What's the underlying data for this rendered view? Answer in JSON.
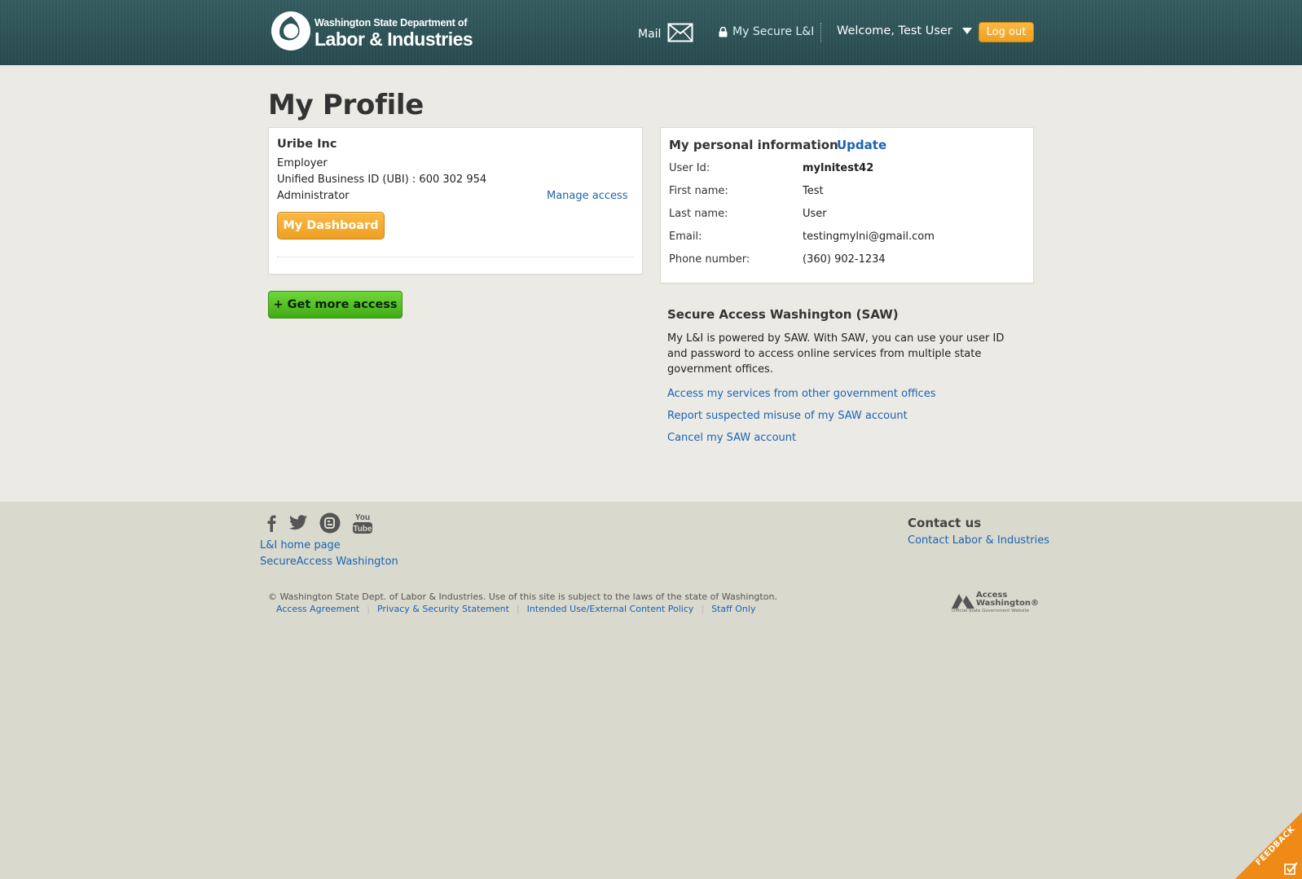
{
  "header": {
    "logo_line1": "Washington State Department of",
    "logo_line2": "Labor & Industries",
    "mail_label": "Mail",
    "mail_icon": "envelope-icon",
    "secure_label": "My Secure L&I",
    "secure_icon": "lock-icon",
    "welcome_label": "Welcome, Test User",
    "welcome_icon": "caret-down-icon",
    "logout_label": "Log out"
  },
  "page": {
    "title": "My Profile"
  },
  "employer": {
    "name": "Uribe Inc",
    "role_type": "Employer",
    "ubi": "Unified Business ID (UBI) : 600 302 954",
    "access_level": "Administrator",
    "manage_access_label": "Manage access",
    "dashboard_label": "My Dashboard"
  },
  "get_more_access_label": "+ Get more access",
  "personal": {
    "title": "My personal information",
    "update_label": "Update",
    "fields": [
      {
        "label": "User Id:",
        "value": "mylnitest42"
      },
      {
        "label": "First name:",
        "value": "Test"
      },
      {
        "label": "Last name:",
        "value": "User"
      },
      {
        "label": "Email:",
        "value": "testingmylni@gmail.com"
      },
      {
        "label": "Phone number:",
        "value": "(360) 902-1234"
      }
    ]
  },
  "saw": {
    "title": "Secure Access Washington (SAW)",
    "text": "My L&I is powered by SAW. With SAW, you can use your user ID and password to access online services from multiple state government offices.",
    "links": [
      "Access my services from other government offices",
      "Report suspected misuse of my SAW account",
      "Cancel my SAW account"
    ]
  },
  "footer": {
    "social_icons": [
      "facebook-icon",
      "twitter-icon",
      "blogger-icon",
      "youtube-icon"
    ],
    "youtube_text": "You Tube",
    "links": [
      "L&I home page",
      "SecureAccess Washington"
    ],
    "contact_title": "Contact us",
    "contact_link": "Contact Labor & Industries",
    "copyright": "© Washington State Dept. of Labor & Industries. Use of this site is subject to the laws of the state of Washington.",
    "legal_links": [
      "Access Agreement",
      "Privacy & Security Statement",
      "Intended Use/External Content Policy",
      "Staff Only"
    ],
    "access_wa_line1": "Access",
    "access_wa_line2": "Washington®",
    "access_wa_tag": "Official State Government Website"
  },
  "feedback": {
    "label": "FEEDBACK"
  },
  "colors": {
    "header_bg": "#2f5559",
    "accent_orange": "#f0a01f",
    "accent_green": "#4cbd1c",
    "link_blue": "#1c63b3",
    "main_bg": "#ebeae5",
    "footer_bg": "#d9d9cd"
  }
}
